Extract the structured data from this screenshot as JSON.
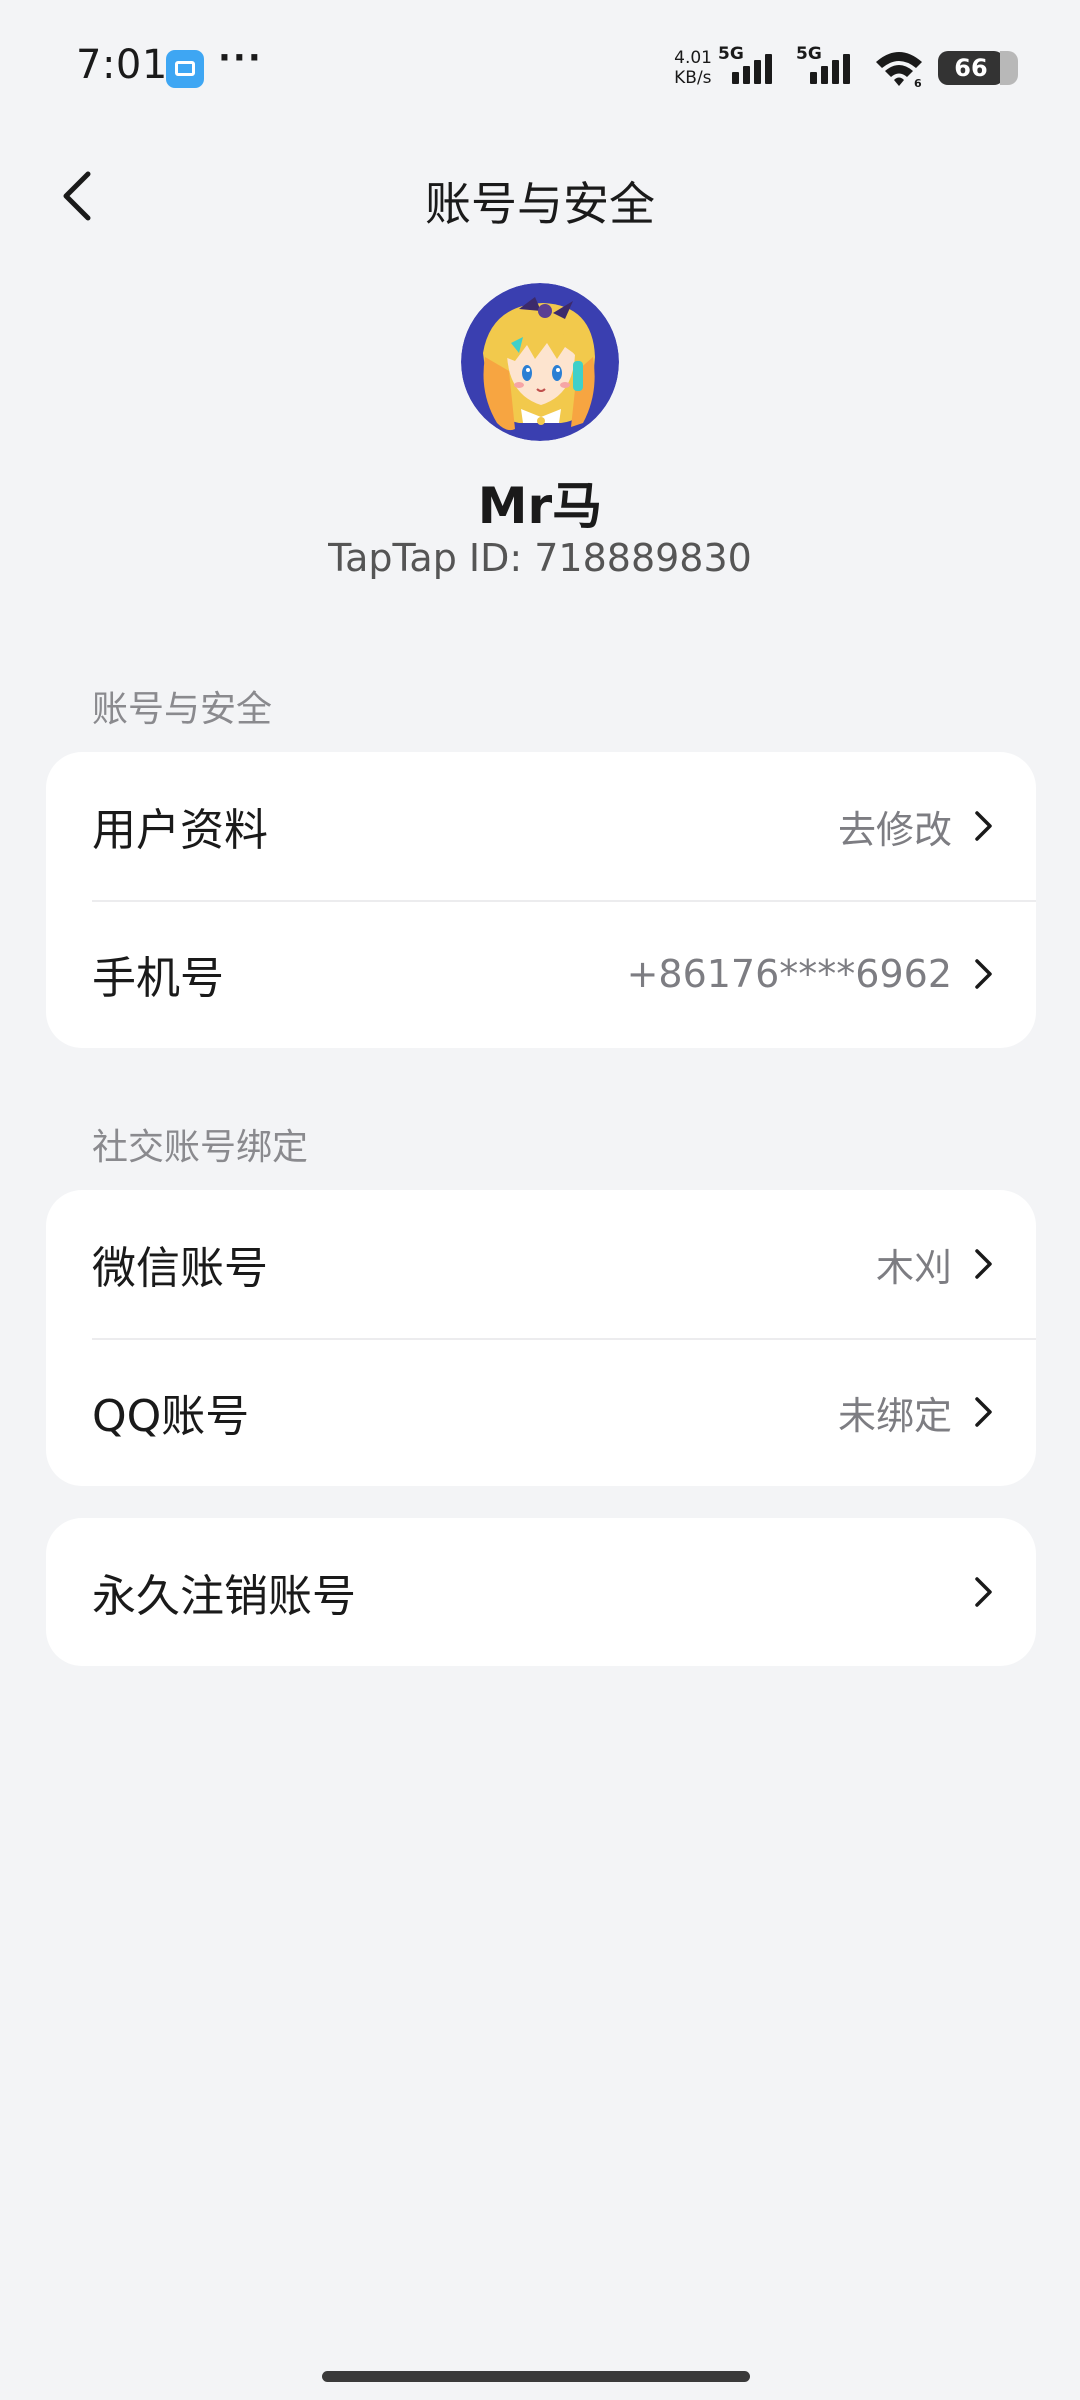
{
  "status_bar": {
    "time": "7:01",
    "more": "···",
    "speed_value": "4.01",
    "speed_unit": "KB/s",
    "net1": "5G",
    "net2": "5G",
    "wifi_badge": "6",
    "battery": "66"
  },
  "nav": {
    "title": "账号与安全"
  },
  "profile": {
    "name": "Mr马",
    "id": "TapTap ID: 718889830"
  },
  "sections": {
    "account": {
      "header": "账号与安全",
      "rows": [
        {
          "label": "用户资料",
          "value": "去修改"
        },
        {
          "label": "手机号",
          "value": "+86176****6962"
        }
      ]
    },
    "social": {
      "header": "社交账号绑定",
      "rows": [
        {
          "label": "微信账号",
          "value": "木刈"
        },
        {
          "label": "QQ账号",
          "value": "未绑定"
        }
      ]
    },
    "danger": {
      "rows": [
        {
          "label": "永久注销账号",
          "value": ""
        }
      ]
    }
  },
  "colors": {
    "background": "#f3f4f6",
    "card": "#ffffff",
    "secondary_text": "#7d7d82",
    "avatar_bg": "#3a3fb0"
  },
  "icons": {
    "back": "back-arrow-icon",
    "chevron": "chevron-right-icon",
    "wallet": "wallet-icon",
    "wifi": "wifi-icon",
    "signal": "signal-icon",
    "battery": "battery-icon"
  }
}
